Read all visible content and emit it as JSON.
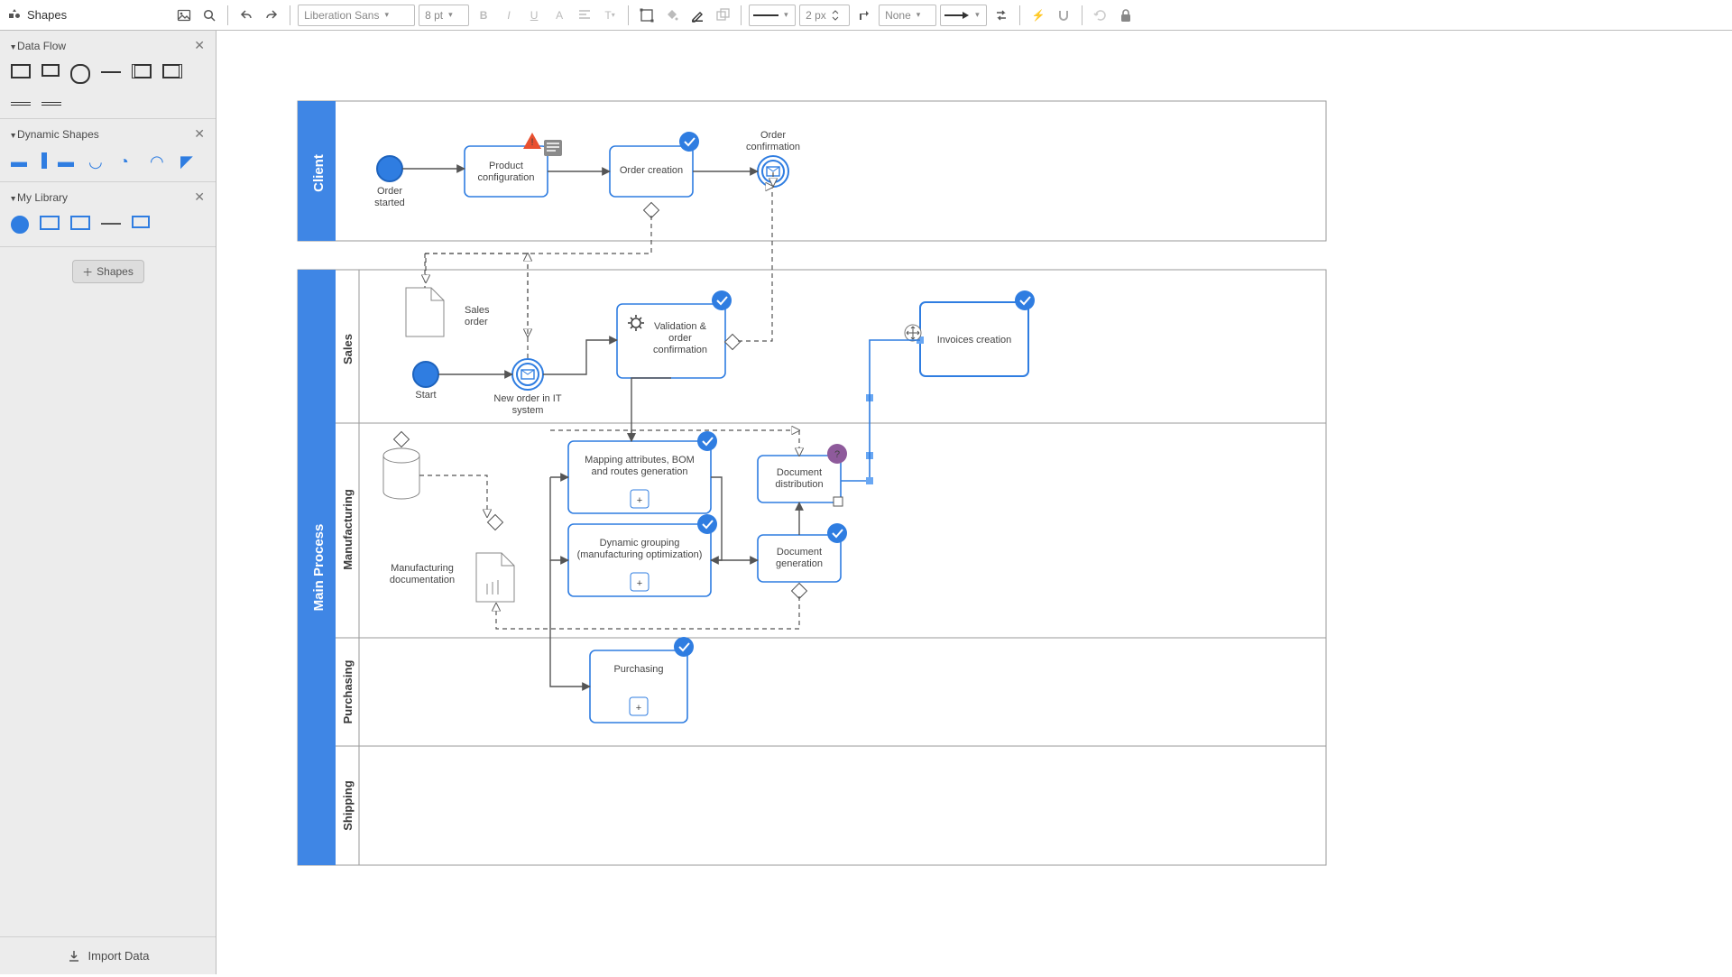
{
  "toolbar": {
    "shapes_label": "Shapes",
    "font": "Liberation Sans",
    "font_size": "8 pt",
    "fill_label": "None",
    "stroke_width": "2 px"
  },
  "sidebar": {
    "groups": [
      {
        "name": "Data Flow"
      },
      {
        "name": "Dynamic Shapes"
      },
      {
        "name": "My Library"
      }
    ],
    "shapes_btn": "Shapes",
    "import": "Import Data"
  },
  "pools": {
    "client": "Client",
    "main": "Main Process"
  },
  "lanes": {
    "sales": "Sales",
    "manufacturing": "Manufacturing",
    "purchasing": "Purchasing",
    "shipping": "Shipping"
  },
  "nodes": {
    "order_started": "Order\nstarted",
    "product_config": "Product\nconfiguration",
    "order_creation": "Order creation",
    "order_confirmation": "Order\nconfirmation",
    "sales_order": "Sales\norder",
    "start": "Start",
    "new_order_it": "New order in IT\nsystem",
    "validation": "Validation &\norder\nconfirmation",
    "invoices": "Invoices creation",
    "mapping": "Mapping attributes, BOM\nand routes generation",
    "dynamic_group": "Dynamic grouping\n(manufacturing optimization)",
    "doc_gen": "Document\ngeneration",
    "doc_dist": "Document\ndistribution",
    "manu_doc": "Manufacturing\ndocumentation",
    "purchasing": "Purchasing"
  }
}
